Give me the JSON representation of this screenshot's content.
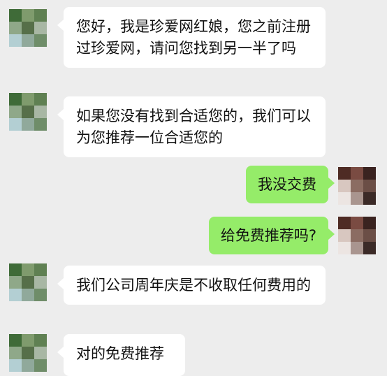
{
  "chat": {
    "messages": [
      {
        "sender": "other",
        "text": "您好，我是珍爱网红娘，您之前注册过珍爱网，请问您找到另一半了吗"
      },
      {
        "sender": "other",
        "text": "如果您没有找到合适您的，我们可以为您推荐一位合适您的"
      },
      {
        "sender": "self",
        "text": "我没交费"
      },
      {
        "sender": "self",
        "text": "给免费推荐吗?"
      },
      {
        "sender": "other",
        "text": "我们公司周年庆是不收取任何费用的"
      },
      {
        "sender": "other",
        "text": "对的免费推荐"
      }
    ]
  },
  "colors": {
    "background": "#ededed",
    "incoming_bubble": "#ffffff",
    "outgoing_bubble": "#95ec69",
    "text": "#111111",
    "incoming_avatar_mosaic": [
      [
        "#3f6b38",
        "#7f9b6d",
        "#5f8052"
      ],
      [
        "#8fa889",
        "#566f49",
        "#a8b7a4"
      ],
      [
        "#b3cfd3",
        "#90a99b",
        "#6f8d69"
      ]
    ],
    "outgoing_avatar_mosaic": [
      [
        "#4e2b24",
        "#7a4b42",
        "#3a2320"
      ],
      [
        "#d8c7c0",
        "#8b6c62",
        "#6b4e46"
      ],
      [
        "#ece5e2",
        "#a9958f",
        "#3b2a27"
      ]
    ]
  }
}
